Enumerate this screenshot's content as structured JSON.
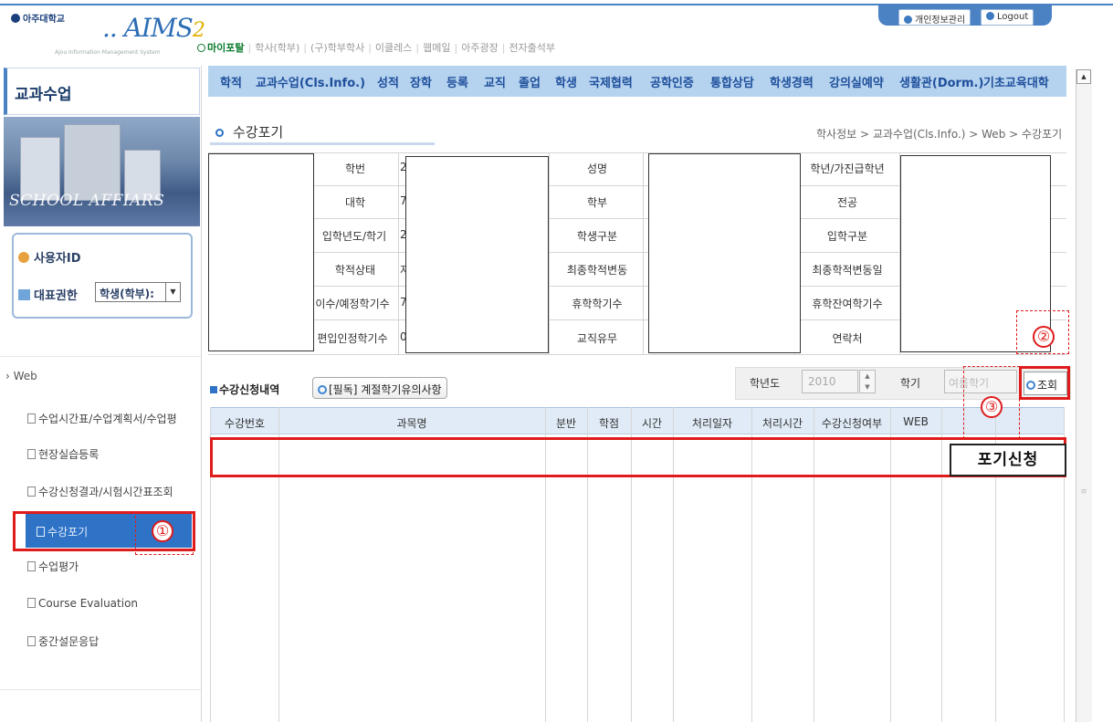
{
  "header": {
    "univ_name": "아주대학교",
    "app_logo": "AIMS",
    "app_logo_num": "2",
    "logo_subtitle": "Ajou Information Management System",
    "top_nav": [
      "마이포탈",
      "학사(학부)",
      "(구)학부학사",
      "이클레스",
      "웹메일",
      "아주광장",
      "전자출석부"
    ],
    "privacy_button": "개인정보관리",
    "logout_button": "Logout"
  },
  "sidebar": {
    "title": "교과수업",
    "banner_text": "SCHOOL AFFIARS",
    "user_id_label": "사용자ID",
    "role_label": "대표권한",
    "role_value": "학생(학부):",
    "web_header": "Web",
    "menu_items": [
      "수업시간표/수업계획서/수업평",
      "현장실습등록",
      "수강신청결과/시험시간표조회",
      "수강포기",
      "수업평가",
      "Course Evaluation",
      "중간설문응답"
    ]
  },
  "main_tabs": [
    "학적",
    "교과수업(Cls.Info.)",
    "성적",
    "장학",
    "등록",
    "교직",
    "졸업",
    "학생",
    "국제협력",
    "공학인증",
    "통합상담",
    "학생경력",
    "강의실예약",
    "생활관(Dorm.)",
    "기초교육대학"
  ],
  "page": {
    "title": "수강포기",
    "breadcrumb": "학사정보 > 교과수업(Cls.Info.) > Web > 수강포기"
  },
  "info": {
    "col1_labels": [
      "학번",
      "대학",
      "입학년도/학기",
      "학적상태",
      "이수/예정학기수",
      "편입인정학기수"
    ],
    "col1_value_peek": [
      "2",
      "7",
      "2",
      "저",
      "7",
      "0"
    ],
    "col2_labels": [
      "성명",
      "학부",
      "학생구분",
      "최종학적변동",
      "휴학학기수",
      "교직유무"
    ],
    "col3_labels": [
      "학년/가진급학년",
      "전공",
      "입학구분",
      "최종학적변동일",
      "휴학잔여학기수",
      "연락처"
    ]
  },
  "list": {
    "section_title": "수강신청내역",
    "notice_button": "[필독] 계절학기유의사항",
    "year_label": "학년도",
    "year_value": "2010",
    "semester_label": "학기",
    "semester_value": "여름학기",
    "search_button": "조회",
    "columns": [
      "수강번호",
      "과목명",
      "분반",
      "학점",
      "시간",
      "처리일자",
      "처리시간",
      "수강신청여부",
      "WEB"
    ],
    "giveup_label": "포기신청"
  },
  "annotations": [
    "①",
    "②",
    "③"
  ],
  "colors": {
    "accent_blue": "#2e73c6",
    "tab_bar": "#b5d3ef",
    "annotation_red": "#e01b1b"
  }
}
